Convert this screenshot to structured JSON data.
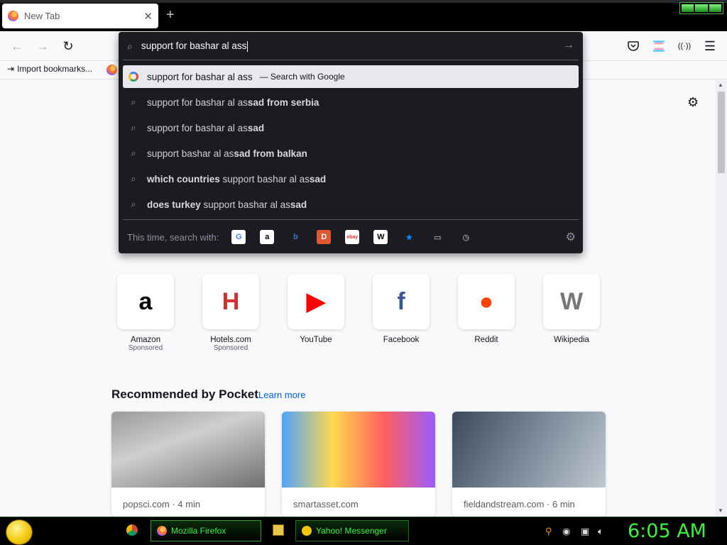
{
  "tab": {
    "title": "New Tab",
    "close": "✕",
    "new_tab": "+"
  },
  "window_controls": [
    "minimize",
    "maximize",
    "close"
  ],
  "toolbar": {
    "back_icon": "←",
    "forward_icon": "→",
    "reload_icon": "↻",
    "pocket_icon": "pocket-icon",
    "account_icon": "account-icon",
    "extension_icon": "extension-icon",
    "menu_icon": "☰"
  },
  "bookmarks": {
    "import_label": "Import bookmarks..."
  },
  "urlbar": {
    "value": "support for bashar al ass",
    "suggestions": [
      {
        "type": "search",
        "plain_pre": "support for bashar al ass",
        "action": "— Search with Google",
        "selected": true
      },
      {
        "pre": "support for bashar al as",
        "bold": "sad from serbia",
        "post": ""
      },
      {
        "pre": "support for bashar al as",
        "bold": "sad",
        "post": ""
      },
      {
        "pre": "support bashar al as",
        "bold": "sad from balkan",
        "post": ""
      },
      {
        "bold_pre": "which countries",
        "pre": " support bashar al as",
        "bold": "sad",
        "post": ""
      },
      {
        "bold_pre": "does turkey",
        "pre": " support bashar al as",
        "bold": "sad",
        "post": ""
      }
    ],
    "oneoff_label": "This time, search with:",
    "engines": [
      {
        "name": "Google",
        "glyph": "G",
        "bg": "#ffffff",
        "fg": "#4285f4"
      },
      {
        "name": "Amazon",
        "glyph": "a",
        "bg": "#ffffff",
        "fg": "#000000"
      },
      {
        "name": "Bing",
        "glyph": "b",
        "bg": "transparent",
        "fg": "#2b7cd3"
      },
      {
        "name": "DuckDuckGo",
        "glyph": "D",
        "bg": "#de5833",
        "fg": "#ffffff"
      },
      {
        "name": "eBay",
        "glyph": "ebay",
        "bg": "#ffffff",
        "fg": "#e53238"
      },
      {
        "name": "Wikipedia",
        "glyph": "W",
        "bg": "#ffffff",
        "fg": "#000000"
      },
      {
        "name": "Bookmarks",
        "glyph": "★",
        "bg": "transparent",
        "fg": "#0a84ff"
      },
      {
        "name": "Tabs",
        "glyph": "▭",
        "bg": "transparent",
        "fg": "#8f8f9d"
      },
      {
        "name": "History",
        "glyph": "◷",
        "bg": "transparent",
        "fg": "#8f8f9d"
      }
    ]
  },
  "top_sites": [
    {
      "name": "Amazon",
      "sponsored": "Sponsored",
      "glyph": "a",
      "color": "#000000"
    },
    {
      "name": "Hotels.com",
      "sponsored": "Sponsored",
      "glyph": "H",
      "color": "#d32f2f"
    },
    {
      "name": "YouTube",
      "sponsored": "",
      "glyph": "▶",
      "color": "#ff0000"
    },
    {
      "name": "Facebook",
      "sponsored": "",
      "glyph": "f",
      "color": "#3b5998"
    },
    {
      "name": "Reddit",
      "sponsored": "",
      "glyph": "●",
      "color": "#ff4500"
    },
    {
      "name": "Wikipedia",
      "sponsored": "",
      "glyph": "W",
      "color": "#777777"
    }
  ],
  "pocket": {
    "title": "Recommended by Pocket",
    "learn_more": "Learn more",
    "cards": [
      {
        "source": "popsci.com · 4 min",
        "img_bg": "linear-gradient(160deg,#9a9a9a,#cfcfcf 40%,#6f6f6f)"
      },
      {
        "source": "smartasset.com",
        "img_bg": "linear-gradient(90deg,#4fa3ff,#ffd84f,#ff5f5f,#9c5cff)"
      },
      {
        "source": "fieldandstream.com · 6 min",
        "img_bg": "linear-gradient(120deg,#3a4a5a,#7a8a9a 50%,#c0c8d0)"
      }
    ]
  },
  "taskbar": {
    "firefox_label": "Mozilla Firefox",
    "messenger_label": "Yahoo! Messenger",
    "clock": "6:05 AM"
  }
}
